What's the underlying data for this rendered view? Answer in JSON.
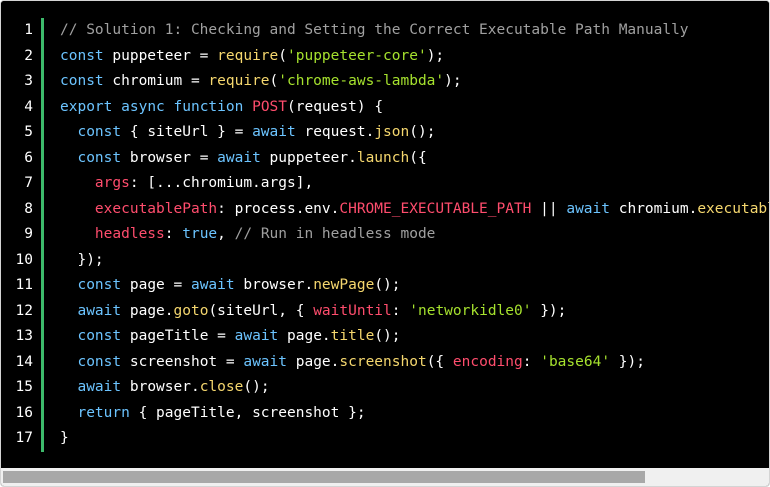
{
  "colors": {
    "background": "#000000",
    "gutter_rule": "#3dba6b",
    "comment": "#a0a0a0",
    "keyword": "#6cc4ff",
    "string": "#a6e22e",
    "function": "#f5d76e",
    "property": "#ff4d6d",
    "text": "#ffffff"
  },
  "editor": {
    "lines": [
      {
        "n": "1",
        "tokens": [
          [
            "comment",
            "// Solution 1: Checking and Setting the Correct Executable Path Manually"
          ]
        ]
      },
      {
        "n": "2",
        "tokens": [
          [
            "keyword",
            "const"
          ],
          [
            "plain",
            " puppeteer = "
          ],
          [
            "func",
            "require"
          ],
          [
            "plain",
            "("
          ],
          [
            "string",
            "'puppeteer-core'"
          ],
          [
            "plain",
            ");"
          ]
        ]
      },
      {
        "n": "3",
        "tokens": [
          [
            "keyword",
            "const"
          ],
          [
            "plain",
            " chromium = "
          ],
          [
            "func",
            "require"
          ],
          [
            "plain",
            "("
          ],
          [
            "string",
            "'chrome-aws-lambda'"
          ],
          [
            "plain",
            ");"
          ]
        ]
      },
      {
        "n": "4",
        "tokens": [
          [
            "keyword",
            "export"
          ],
          [
            "plain",
            " "
          ],
          [
            "keyword",
            "async"
          ],
          [
            "plain",
            " "
          ],
          [
            "keyword",
            "function"
          ],
          [
            "plain",
            " "
          ],
          [
            "prop",
            "POST"
          ],
          [
            "plain",
            "(request) {"
          ]
        ]
      },
      {
        "n": "5",
        "tokens": [
          [
            "plain",
            "  "
          ],
          [
            "keyword",
            "const"
          ],
          [
            "plain",
            " { siteUrl } = "
          ],
          [
            "keyword",
            "await"
          ],
          [
            "plain",
            " request."
          ],
          [
            "func",
            "json"
          ],
          [
            "plain",
            "();"
          ]
        ]
      },
      {
        "n": "6",
        "tokens": [
          [
            "plain",
            "  "
          ],
          [
            "keyword",
            "const"
          ],
          [
            "plain",
            " browser = "
          ],
          [
            "keyword",
            "await"
          ],
          [
            "plain",
            " puppeteer."
          ],
          [
            "func",
            "launch"
          ],
          [
            "plain",
            "({"
          ]
        ]
      },
      {
        "n": "7",
        "tokens": [
          [
            "plain",
            "    "
          ],
          [
            "prop",
            "args"
          ],
          [
            "plain",
            ": [...chromium.args],"
          ]
        ]
      },
      {
        "n": "8",
        "tokens": [
          [
            "plain",
            "    "
          ],
          [
            "prop",
            "executablePath"
          ],
          [
            "plain",
            ": process.env."
          ],
          [
            "prop",
            "CHROME_EXECUTABLE_PATH"
          ],
          [
            "plain",
            " || "
          ],
          [
            "keyword",
            "await"
          ],
          [
            "plain",
            " chromium."
          ],
          [
            "func",
            "executablePath"
          ]
        ]
      },
      {
        "n": "9",
        "tokens": [
          [
            "plain",
            "    "
          ],
          [
            "prop",
            "headless"
          ],
          [
            "plain",
            ": "
          ],
          [
            "keyword",
            "true"
          ],
          [
            "plain",
            ", "
          ],
          [
            "comment",
            "// Run in headless mode"
          ]
        ]
      },
      {
        "n": "10",
        "tokens": [
          [
            "plain",
            "  });"
          ]
        ]
      },
      {
        "n": "11",
        "tokens": [
          [
            "plain",
            "  "
          ],
          [
            "keyword",
            "const"
          ],
          [
            "plain",
            " page = "
          ],
          [
            "keyword",
            "await"
          ],
          [
            "plain",
            " browser."
          ],
          [
            "func",
            "newPage"
          ],
          [
            "plain",
            "();"
          ]
        ]
      },
      {
        "n": "12",
        "tokens": [
          [
            "plain",
            "  "
          ],
          [
            "keyword",
            "await"
          ],
          [
            "plain",
            " page."
          ],
          [
            "func",
            "goto"
          ],
          [
            "plain",
            "(siteUrl, { "
          ],
          [
            "prop",
            "waitUntil"
          ],
          [
            "plain",
            ": "
          ],
          [
            "string",
            "'networkidle0'"
          ],
          [
            "plain",
            " });"
          ]
        ]
      },
      {
        "n": "13",
        "tokens": [
          [
            "plain",
            "  "
          ],
          [
            "keyword",
            "const"
          ],
          [
            "plain",
            " pageTitle = "
          ],
          [
            "keyword",
            "await"
          ],
          [
            "plain",
            " page."
          ],
          [
            "func",
            "title"
          ],
          [
            "plain",
            "();"
          ]
        ]
      },
      {
        "n": "14",
        "tokens": [
          [
            "plain",
            "  "
          ],
          [
            "keyword",
            "const"
          ],
          [
            "plain",
            " screenshot = "
          ],
          [
            "keyword",
            "await"
          ],
          [
            "plain",
            " page."
          ],
          [
            "func",
            "screenshot"
          ],
          [
            "plain",
            "({ "
          ],
          [
            "prop",
            "encoding"
          ],
          [
            "plain",
            ": "
          ],
          [
            "string",
            "'base64'"
          ],
          [
            "plain",
            " });"
          ]
        ]
      },
      {
        "n": "15",
        "tokens": [
          [
            "plain",
            "  "
          ],
          [
            "keyword",
            "await"
          ],
          [
            "plain",
            " browser."
          ],
          [
            "func",
            "close"
          ],
          [
            "plain",
            "();"
          ]
        ]
      },
      {
        "n": "16",
        "tokens": [
          [
            "plain",
            "  "
          ],
          [
            "keyword",
            "return"
          ],
          [
            "plain",
            " { pageTitle, screenshot };"
          ]
        ]
      },
      {
        "n": "17",
        "tokens": [
          [
            "plain",
            "}"
          ]
        ]
      }
    ]
  },
  "scrollbar": {
    "visible_fraction": 0.84,
    "position_fraction": 0
  }
}
